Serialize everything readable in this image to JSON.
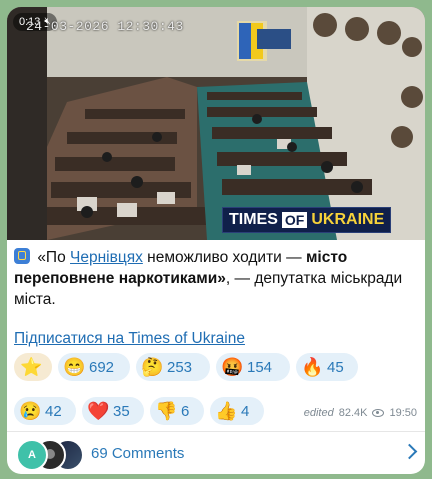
{
  "video": {
    "duration": "0:13",
    "mute_icon": "muted-speaker-icon",
    "timestamp_overlay": "24-03-2026 12:30:43",
    "brand_times": "TIMES",
    "brand_of": "OF",
    "brand_ukraine": "UKRAINE"
  },
  "post": {
    "icon": "building-icon",
    "quote_open": "«По ",
    "link_city": "Чернівцях",
    "text_part1": " неможливо ходити — ",
    "bold_part": "місто переповнене наркотиками»",
    "text_part2": ", — депутатка міськради міста.",
    "subscribe_link": "Підписатися на Times of Ukraine"
  },
  "reactions": [
    {
      "emoji": "⭐",
      "name": "star-reaction",
      "count": ""
    },
    {
      "emoji": "😁",
      "name": "grin-reaction",
      "count": "692"
    },
    {
      "emoji": "🤔",
      "name": "thinking-reaction",
      "count": "253"
    },
    {
      "emoji": "🤬",
      "name": "cursing-reaction",
      "count": "154"
    },
    {
      "emoji": "🔥",
      "name": "fire-reaction",
      "count": "45"
    },
    {
      "emoji": "😢",
      "name": "crying-reaction",
      "count": "42"
    },
    {
      "emoji": "❤️",
      "name": "heart-reaction",
      "count": "35"
    },
    {
      "emoji": "👎",
      "name": "thumbs-down-reaction",
      "count": "6"
    },
    {
      "emoji": "👍",
      "name": "thumbs-up-reaction",
      "count": "4"
    }
  ],
  "meta": {
    "edited": "edited",
    "views": "82.4K",
    "time": "19:50"
  },
  "comments": {
    "avatar_letter": "A",
    "label": "69 Comments"
  },
  "colors": {
    "background": "#8fb98d",
    "link": "#1f6db3",
    "reaction_chip": "#e4f0f9",
    "brand_navy": "#10204a"
  }
}
